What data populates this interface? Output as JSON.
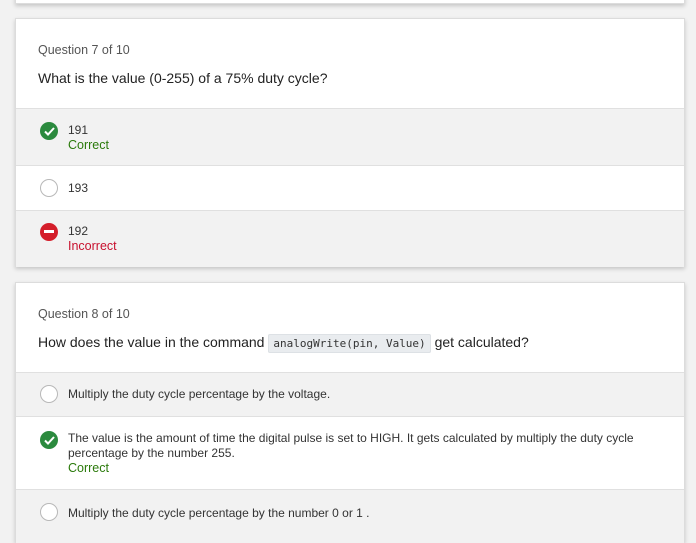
{
  "questions": [
    {
      "number": "Question 7 of 10",
      "prompt": "What is the value (0-255) of a 75% duty cycle?",
      "options": [
        {
          "label": "191",
          "state": "correct",
          "status": "Correct"
        },
        {
          "label": "193",
          "state": "unselected",
          "status": ""
        },
        {
          "label": "192",
          "state": "incorrect",
          "status": "Incorrect"
        }
      ]
    },
    {
      "number": "Question 8 of 10",
      "prompt_before": "How does the value in the command",
      "prompt_code": "analogWrite(pin, Value)",
      "prompt_after": "get calculated?",
      "options": [
        {
          "label": "Multiply the duty cycle percentage by the voltage.",
          "state": "unselected",
          "status": ""
        },
        {
          "label": "The value is the amount of time the digital pulse is set to HIGH. It gets calculated by multiply the duty cycle percentage by the number 255.",
          "state": "correct",
          "status": "Correct"
        },
        {
          "label": "Multiply the duty cycle percentage by the number 0 or 1 .",
          "state": "unselected",
          "status": ""
        }
      ]
    }
  ],
  "colors": {
    "correct": "#2b8a3e",
    "incorrect": "#d41e2a",
    "correct_text": "#2b7a0b",
    "incorrect_text": "#c8102e"
  }
}
